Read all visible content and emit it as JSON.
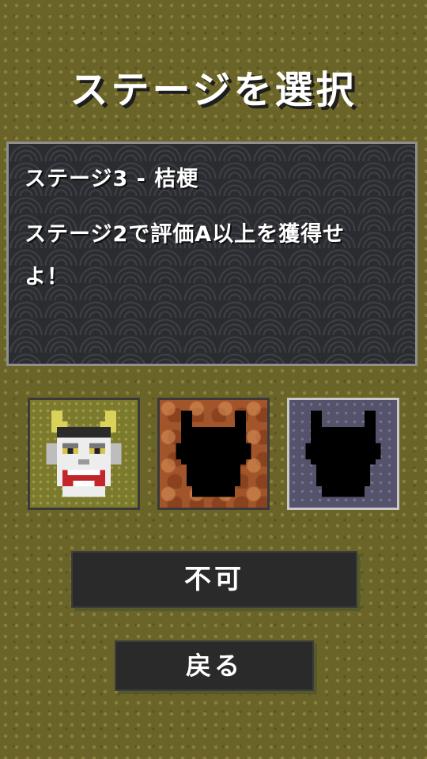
{
  "screen": {
    "title": "ステージを選択"
  },
  "stage_info": {
    "name": "ステージ3 - 桔梗",
    "requirement": "ステージ2で評価A以上を獲得せよ！"
  },
  "masks": [
    {
      "name": "oni-mask-unlocked",
      "state": "unlocked"
    },
    {
      "name": "oni-mask-locked-silhouette",
      "state": "locked"
    },
    {
      "name": "oni-mask-locked-silhouette",
      "state": "locked",
      "selected": true
    }
  ],
  "buttons": {
    "select_label": "不可",
    "back_label": "戻る"
  },
  "colors": {
    "background": "#6b6428",
    "panel": "#2b2c30",
    "button": "#2a2a2a",
    "text": "#ffffff"
  }
}
